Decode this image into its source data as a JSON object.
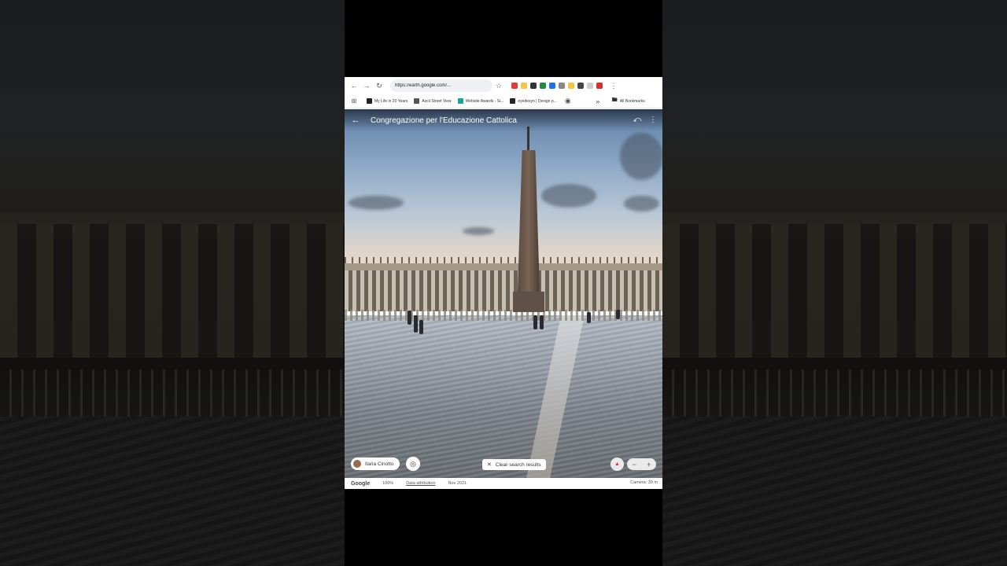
{
  "browser": {
    "url": "https://earth.google.com/...",
    "bookmarks": [
      {
        "label": "My Life in 20 Years",
        "color": "#222222"
      },
      {
        "label": "Ascii Street View",
        "color": "#555555"
      },
      {
        "label": "Website Awards - Si...",
        "color": "#1aa39a"
      },
      {
        "label": "eyedesyn | Design p...",
        "color": "#222222"
      }
    ],
    "all_bookmarks": "All Bookmarks",
    "extension_colors": [
      "#e53935",
      "#f6c344",
      "#333333",
      "#1e8e3e",
      "#1a73e8",
      "#888888",
      "#f6c344",
      "#444444",
      "#cccccc",
      "#d32f2f"
    ]
  },
  "viewer": {
    "title": "Congregazione per l'Educazione Cattolica",
    "author": "Ilaria Cinotto",
    "clear_search": "Clear search results"
  },
  "statusbar": {
    "brand": "Google",
    "zoom": "100%",
    "attribution": "Data attribution",
    "date": "Nov 2021",
    "camera": "Camera: 39 m"
  },
  "icons": {
    "back": "arrow-left-icon",
    "share": "share-icon",
    "more": "more-vert-icon",
    "lens": "lens-icon",
    "compass": "compass-icon"
  }
}
